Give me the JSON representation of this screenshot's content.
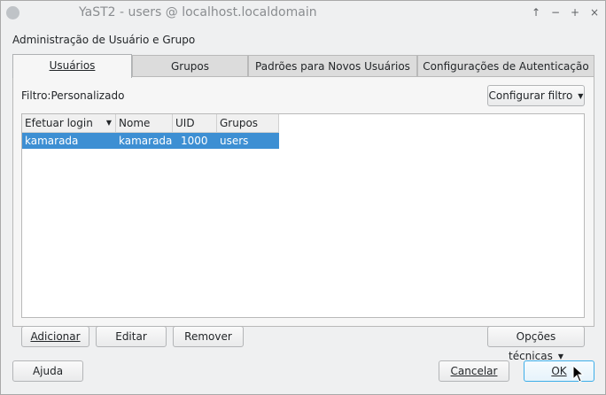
{
  "window": {
    "title": "YaST2 - users @ localhost.localdomain",
    "controls": [
      "↑",
      "−",
      "+",
      "×"
    ]
  },
  "dialog": {
    "heading": "Administração de Usuário e Grupo"
  },
  "tabs": [
    {
      "label": "Usuários"
    },
    {
      "label": "Grupos"
    },
    {
      "label": "Padrões para Novos Usuários"
    },
    {
      "label": "Configurações de Autenticação"
    }
  ],
  "filter": {
    "label": "Filtro:Personalizado",
    "button": "Configurar filtro"
  },
  "table": {
    "headers": [
      "Efetuar login",
      "Nome",
      "UID",
      "Grupos"
    ],
    "rows": [
      [
        "kamarada",
        "kamarada",
        "1000",
        "users"
      ]
    ]
  },
  "actions": {
    "add": "Adicionar",
    "edit": "Editar",
    "remove": "Remover",
    "expert": "Opções técnicas"
  },
  "footer": {
    "help": "Ajuda",
    "cancel": "Cancelar",
    "ok": "OK"
  },
  "colors": {
    "selection": "#3d8fd3",
    "focus": "#3daee9"
  }
}
